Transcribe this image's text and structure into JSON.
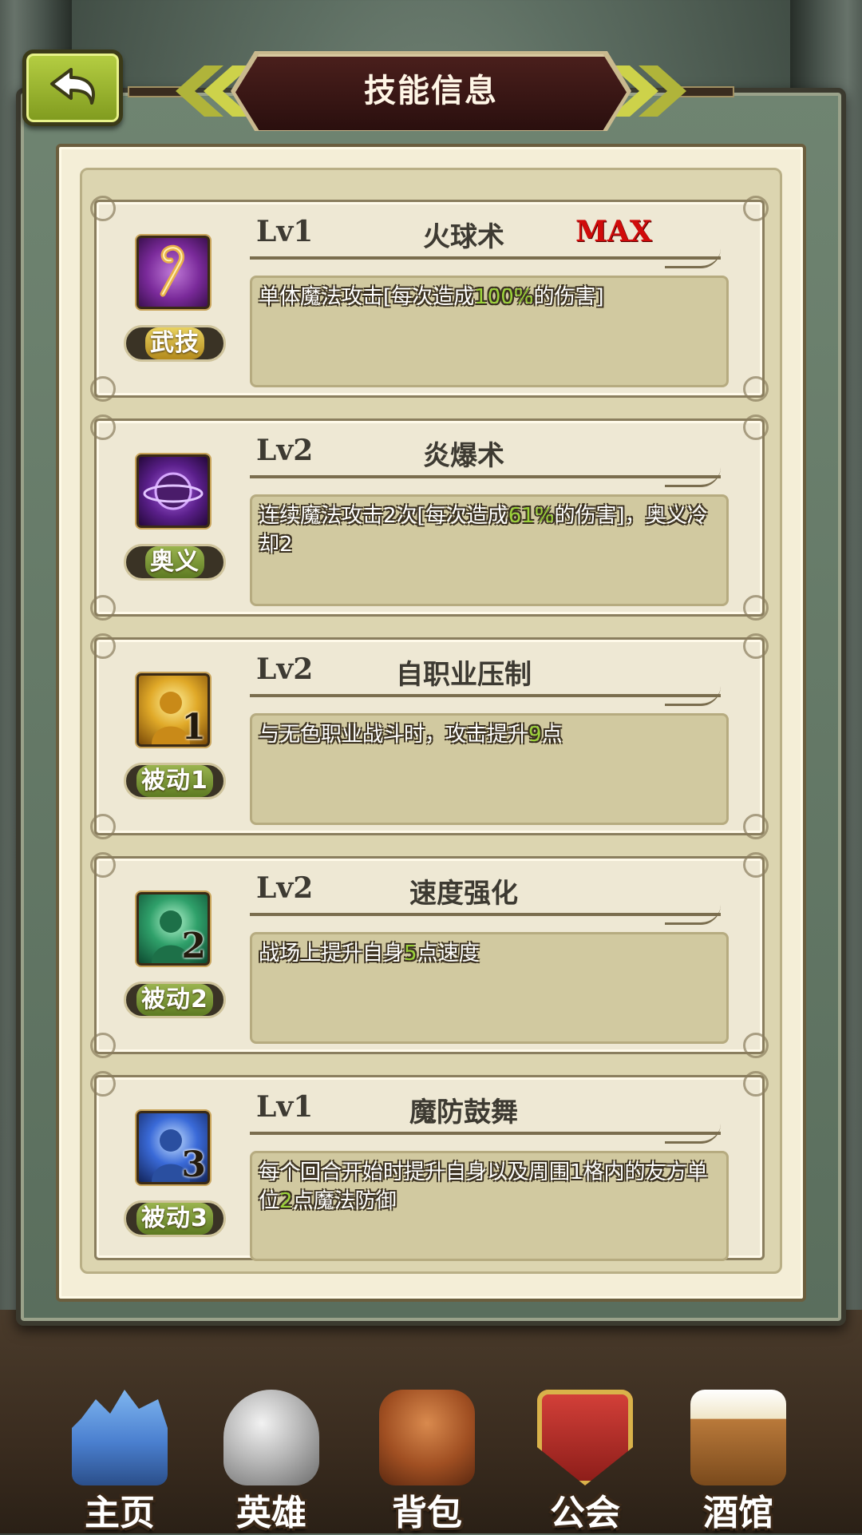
{
  "header": {
    "title": "技能信息"
  },
  "skills": [
    {
      "level": "Lv1",
      "name": "火球术",
      "max": "MAX",
      "type": "武技",
      "desc_parts": [
        "单体魔法攻击[每次造成",
        "100%",
        "的伤害]"
      ]
    },
    {
      "level": "Lv2",
      "name": "炎爆术",
      "max": "",
      "type": "奥义",
      "desc_parts": [
        "连续魔法攻击2次[每次造成",
        "61%",
        "的伤害]，奥义冷却2"
      ]
    },
    {
      "level": "Lv2",
      "name": "自职业压制",
      "max": "",
      "type": "被动1",
      "icon_number": "1",
      "desc_parts": [
        "与无色职业战斗时，攻击提升",
        "9",
        "点"
      ]
    },
    {
      "level": "Lv2",
      "name": "速度强化",
      "max": "",
      "type": "被动2",
      "icon_number": "2",
      "desc_parts": [
        "战场上提升自身",
        "5",
        "点速度"
      ]
    },
    {
      "level": "Lv1",
      "name": "魔防鼓舞",
      "max": "",
      "type": "被动3",
      "icon_number": "3",
      "desc_parts": [
        "每个回合开始时提升自身以及周围1格内的友方单位",
        "2",
        "点魔法防御"
      ]
    }
  ],
  "nav": {
    "home": "主页",
    "heroes": "英雄",
    "bag": "背包",
    "guild": "公会",
    "tavern": "酒馆"
  },
  "icons": {
    "back": "back-arrow-icon",
    "skill1": "staff-icon",
    "skill2": "dark-orb-icon",
    "skill3": "passive-gold-icon",
    "skill4": "passive-green-icon",
    "skill5": "passive-blue-icon"
  },
  "colors": {
    "max_red": "#d00b0b",
    "highlight_green": "#9bd23a",
    "back_button": "#9ab72e"
  }
}
